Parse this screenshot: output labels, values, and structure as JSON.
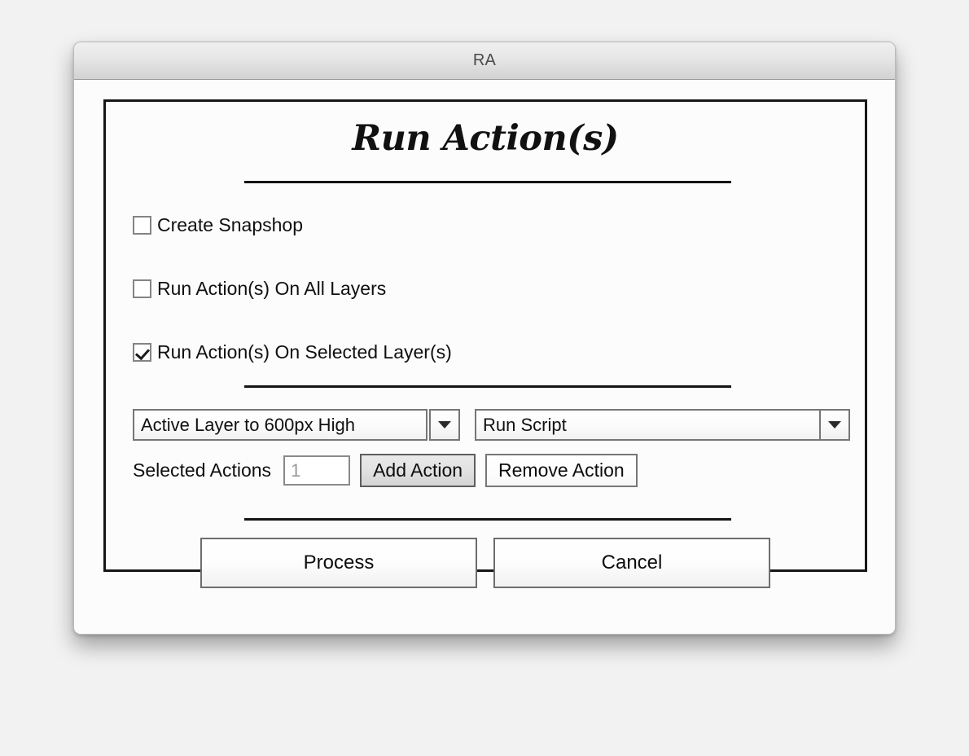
{
  "window": {
    "title": "RA"
  },
  "dialog": {
    "heading": "Run Action(s)",
    "checkboxes": [
      {
        "label": "Create Snapshop",
        "checked": false
      },
      {
        "label": "Run Action(s) On All Layers",
        "checked": false
      },
      {
        "label": "Run Action(s) On Selected Layer(s)",
        "checked": true
      }
    ],
    "action_dropdown": {
      "value": "Active Layer to 600px High",
      "arrow_icon": "chevron-down-icon"
    },
    "script_dropdown": {
      "value": "Run Script",
      "arrow_icon": "chevron-down-icon"
    },
    "selected_actions": {
      "label": "Selected Actions",
      "value": "1",
      "add_label": "Add Action",
      "remove_label": "Remove Action"
    },
    "footer": {
      "process_label": "Process",
      "cancel_label": "Cancel"
    }
  },
  "colors": {
    "panel_border": "#171717",
    "separator": "#141414",
    "titlebar_text": "#4a4a4a",
    "primary_button_bg": "#e2e2e2",
    "page_background": "#f2f2f2"
  }
}
